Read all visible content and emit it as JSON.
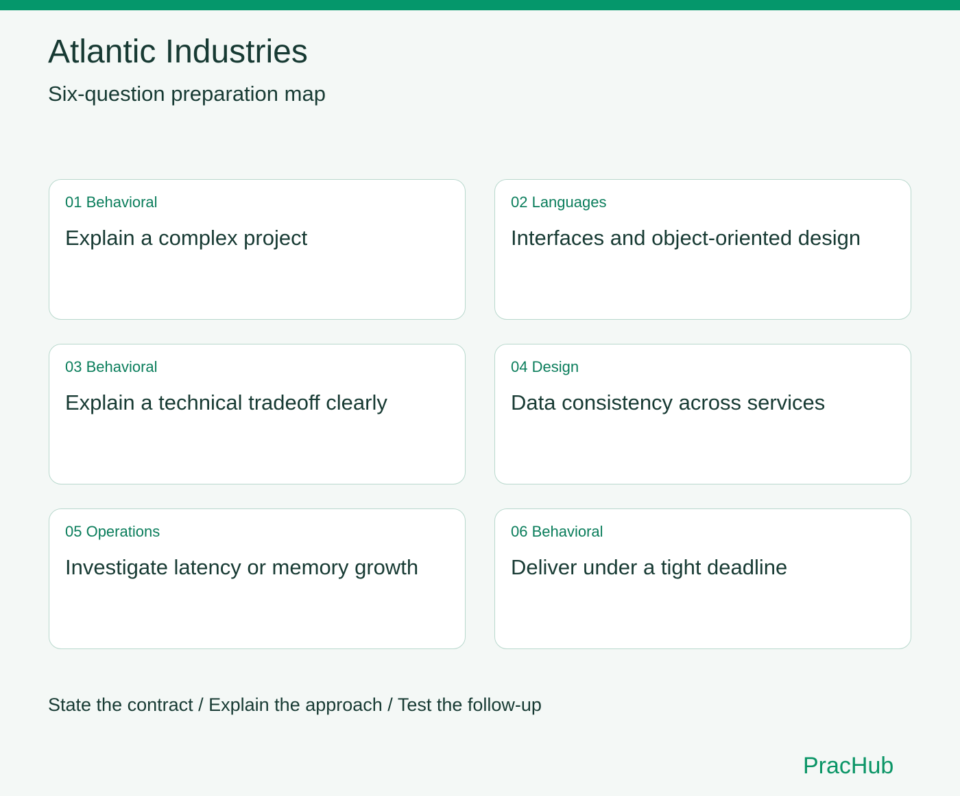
{
  "header": {
    "title": "Atlantic Industries",
    "subtitle": "Six-question preparation map"
  },
  "cards": [
    {
      "tag": "01 Behavioral",
      "title": "Explain a complex project"
    },
    {
      "tag": "02 Languages",
      "title": "Interfaces and object-oriented design"
    },
    {
      "tag": "03 Behavioral",
      "title": "Explain a technical tradeoff clearly"
    },
    {
      "tag": "04 Design",
      "title": "Data consistency across services"
    },
    {
      "tag": "05 Operations",
      "title": "Investigate latency or memory growth"
    },
    {
      "tag": "06 Behavioral",
      "title": "Deliver under a tight deadline"
    }
  ],
  "footer": {
    "steps": "State the contract / Explain the approach / Test the follow-up",
    "brand": "PracHub"
  },
  "colors": {
    "accent": "#05976b",
    "tag_text": "#0a7d5b",
    "text": "#173a33",
    "card_border": "#b8d8cd",
    "background": "#f4f8f6"
  }
}
